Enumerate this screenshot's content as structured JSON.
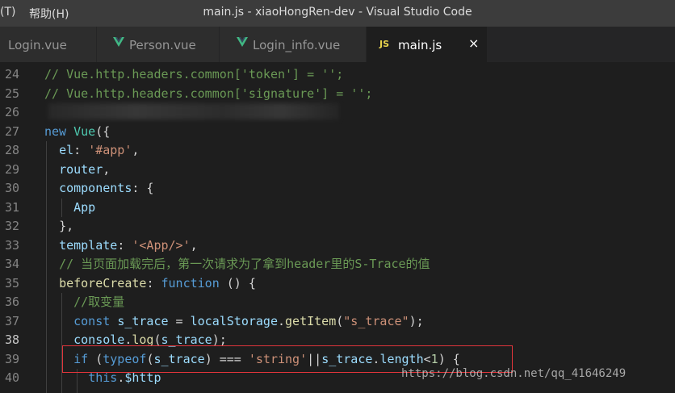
{
  "titlebar": {
    "menu_fragment": "(T)",
    "help_menu": "帮助(H)",
    "title": "main.js - xiaoHongRen-dev - Visual Studio Code"
  },
  "tabs": [
    {
      "label": "Login.vue",
      "icon": "vue-icon",
      "active": false
    },
    {
      "label": "Person.vue",
      "icon": "vue-icon",
      "active": false
    },
    {
      "label": "Login_info.vue",
      "icon": "vue-icon",
      "active": false
    },
    {
      "label": "main.js",
      "icon": "js-icon",
      "icon_text": "JS",
      "active": true
    }
  ],
  "close_glyph": "×",
  "colors": {
    "accent_highlight": "#e0353b",
    "vue_green": "#41b883",
    "js_yellow": "#e8d44d",
    "editor_bg": "#1e1e1e"
  },
  "line_numbers": [
    "24",
    "25",
    "26",
    "27",
    "28",
    "29",
    "30",
    "31",
    "32",
    "33",
    "34",
    "35",
    "36",
    "37",
    "38",
    "39",
    "40"
  ],
  "active_line": "38",
  "code": {
    "l24": "// Vue.http.headers.common['token'] = '';",
    "l25": "// Vue.http.headers.common['signature'] = '';",
    "l27_kw": "new",
    "l27_cls": "Vue",
    "l27_rest": "({",
    "l28_prop": "el",
    "l28_str": "'#app'",
    "l29_prop": "router",
    "l30_prop": "components",
    "l31_cls": "App",
    "l32": "},",
    "l33_prop": "template",
    "l33_str": "'<App/>'",
    "l34": "// 当页面加载完后，第一次请求为了拿到header里的S-Trace的值",
    "l35_fn": "beforeCreate",
    "l35_kw": "function",
    "l35_rest": " () {",
    "l36": "//取变量",
    "l37_kw": "const",
    "l37_var": "s_trace",
    "l37_obj": "localStorage",
    "l37_fn": "getItem",
    "l37_str": "\"s_trace\"",
    "l38_obj": "console",
    "l38_fn": "log",
    "l38_var": "s_trace",
    "l39_if": "if",
    "l39_kw": "typeof",
    "l39_var": "s_trace",
    "l39_op": "===",
    "l39_str": "'string'",
    "l39_var2": "s_trace",
    "l39_prop": "length",
    "l39_num": "1",
    "l40_kw": "this",
    "l40_prop": "$http"
  },
  "watermark": "https://blog.csdn.net/qq_41646249"
}
